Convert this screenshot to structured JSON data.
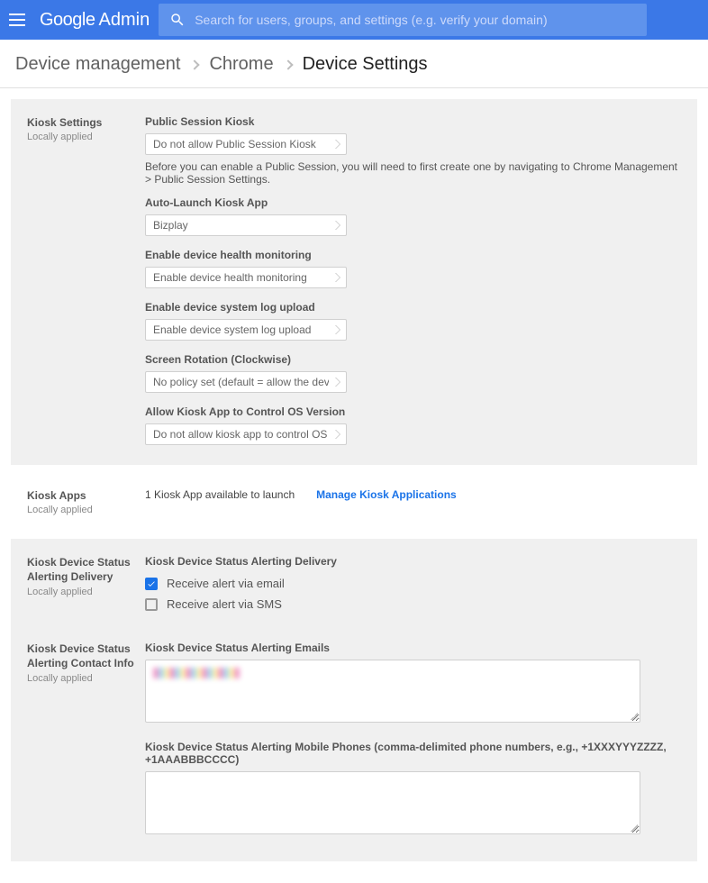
{
  "header": {
    "logo_google": "Google",
    "logo_admin": "Admin",
    "search_placeholder": "Search for users, groups, and settings (e.g. verify your domain)"
  },
  "breadcrumb": {
    "item1": "Device management",
    "item2": "Chrome",
    "item3": "Device Settings"
  },
  "sections": {
    "kiosk_settings": {
      "title": "Kiosk Settings",
      "applied": "Locally applied",
      "fields": {
        "public_session_label": "Public Session Kiosk",
        "public_session_value": "Do not allow Public Session Kiosk",
        "public_session_help": "Before you can enable a Public Session, you will need to first create one by navigating to Chrome Management > Public Session Settings.",
        "auto_launch_label": "Auto-Launch Kiosk App",
        "auto_launch_value": "Bizplay",
        "health_monitor_label": "Enable device health monitoring",
        "health_monitor_value": "Enable device health monitoring",
        "syslog_label": "Enable device system log upload",
        "syslog_value": "Enable device system log upload",
        "rotation_label": "Screen Rotation (Clockwise)",
        "rotation_value": "No policy set (default = allow the device to keep",
        "os_version_label": "Allow Kiosk App to Control OS Version",
        "os_version_value": "Do not allow kiosk app to control OS version"
      }
    },
    "kiosk_apps": {
      "title": "Kiosk Apps",
      "applied": "Locally applied",
      "available_text": "1 Kiosk App available to launch",
      "manage_link": "Manage Kiosk Applications"
    },
    "alerting_delivery": {
      "title": "Kiosk Device Status Alerting Delivery",
      "applied": "Locally applied",
      "heading": "Kiosk Device Status Alerting Delivery",
      "email_label": "Receive alert via email",
      "sms_label": "Receive alert via SMS"
    },
    "alerting_contact": {
      "title": "Kiosk Device Status Alerting Contact Info",
      "applied": "Locally applied",
      "emails_label": "Kiosk Device Status Alerting Emails",
      "phones_label": "Kiosk Device Status Alerting Mobile Phones (comma-delimited phone numbers, e.g., +1XXXYYYZZZZ, +1AAABBBCCCC)"
    }
  }
}
